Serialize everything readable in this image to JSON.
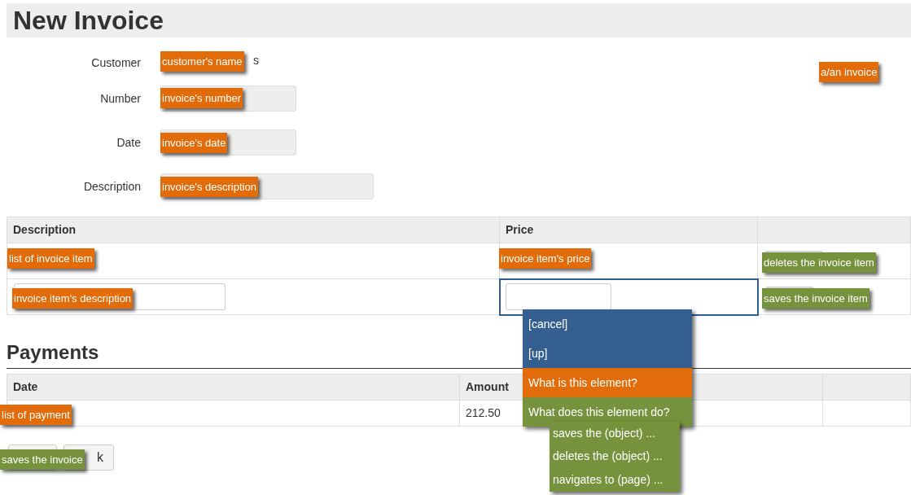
{
  "title": "New Invoice",
  "fields": [
    {
      "label": "Customer",
      "kind": "text",
      "value": "s"
    },
    {
      "label": "Number",
      "kind": "input"
    },
    {
      "label": "Date",
      "kind": "input"
    },
    {
      "label": "Description",
      "kind": "wide_input"
    }
  ],
  "items_table": {
    "columns": [
      {
        "label": "Description"
      },
      {
        "label": "Price"
      }
    ],
    "edit_row": {
      "price_focused": true
    }
  },
  "payments": {
    "heading": "Payments",
    "columns": [
      {
        "label": "Date"
      },
      {
        "label": "Amount"
      }
    ],
    "rows": [
      {
        "amount": "212.50"
      }
    ]
  },
  "back_button": {
    "label": "k"
  },
  "annotations": [
    {
      "text": "customer's name",
      "kind": "what"
    },
    {
      "text": "invoice's number",
      "kind": "what"
    },
    {
      "text": "invoice's date",
      "kind": "what"
    },
    {
      "text": "invoice's description",
      "kind": "what"
    },
    {
      "text": "a/an invoice",
      "kind": "what"
    },
    {
      "text": "list of invoice item",
      "kind": "what"
    },
    {
      "text": "invoice item's price",
      "kind": "what"
    },
    {
      "text": "deletes the invoice item",
      "kind": "does"
    },
    {
      "text": "invoice item's description",
      "kind": "what"
    },
    {
      "text": "saves the invoice item",
      "kind": "does"
    },
    {
      "text": "list of payment",
      "kind": "what"
    },
    {
      "text": "saves the invoice",
      "kind": "does"
    }
  ],
  "context_menu": {
    "items": [
      {
        "label": "[cancel]",
        "kind": "nav"
      },
      {
        "label": "[up]",
        "kind": "nav"
      },
      {
        "label": "What is this element?",
        "kind": "what"
      },
      {
        "label": "What does this element do?",
        "kind": "does"
      }
    ],
    "submenu": [
      {
        "label": "saves the (object) ..."
      },
      {
        "label": "deletes the (object) ..."
      },
      {
        "label": "navigates to (page) ..."
      }
    ]
  }
}
